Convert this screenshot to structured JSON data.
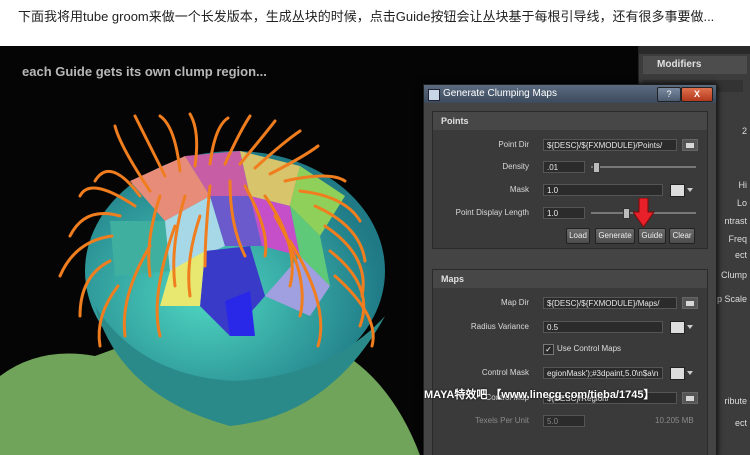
{
  "caption": "下面我将用tube groom来做一个长发版本，生成丛块的时候，点击Guide按钮会让丛块基于每根引导线，还有很多事要做...",
  "viewport": {
    "label": "each Guide gets its own clump region..."
  },
  "attribute_editor": {
    "modifiers_label": "Modifiers",
    "row_labels": [
      "2",
      "Hi",
      "Lo",
      "ntrast",
      "Freq",
      "ect",
      "Clump",
      "p Scale",
      "ribute",
      "ect"
    ]
  },
  "dialog": {
    "title": "Generate Clumping Maps",
    "help_button": "?",
    "close_button": "X",
    "points": {
      "header": "Points",
      "point_dir_label": "Point Dir",
      "point_dir_value": "${DESC}/${FXMODULE}/Points/",
      "density_label": "Density",
      "density_value": ".01",
      "density_level": 0.05,
      "mask_label": "Mask",
      "mask_value": "1.0",
      "display_length_label": "Point Display Length",
      "display_length_value": "1.0",
      "display_length_level": 0.33,
      "buttons": {
        "load": "Load",
        "generate": "Generate",
        "guide": "Guide",
        "clear": "Clear"
      }
    },
    "maps": {
      "header": "Maps",
      "map_dir_label": "Map Dir",
      "map_dir_value": "${DESC}/${FXMODULE}/Maps/",
      "radius_variance_label": "Radius Variance",
      "radius_variance_value": "0.5",
      "use_control_maps_label": "Use Control Maps",
      "use_control_maps_checked": true,
      "control_mask_label": "Control Mask",
      "control_mask_value": "egionMask');#3dpaint,5.0\\n$a\\n",
      "control_map_label": "Control Map",
      "control_map_value": "${DESC}/Region/",
      "texels_label": "Texels Per Unit",
      "texels_value": "5.0",
      "texels_size": "10.205 MB"
    }
  },
  "watermark": "MAYA特效吧 【www.linecg.com/tieba/1745】",
  "colors": {
    "hair": "#f07d1e",
    "arrow": "#e8202a",
    "dialog_bg": "#444444"
  }
}
